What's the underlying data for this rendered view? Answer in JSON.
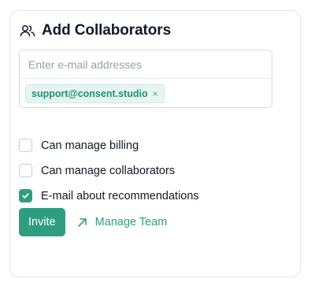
{
  "header": {
    "title": "Add Collaborators",
    "icon": "users-icon"
  },
  "email": {
    "placeholder": "Enter e-mail addresses",
    "value": "",
    "chips": [
      {
        "label": "support@consent.studio",
        "remove_icon": "close-icon"
      }
    ]
  },
  "options": [
    {
      "label": "Can manage billing",
      "checked": false
    },
    {
      "label": "Can manage collaborators",
      "checked": false
    },
    {
      "label": "E-mail about recommendations",
      "checked": true
    }
  ],
  "actions": {
    "invite_label": "Invite",
    "manage_label": "Manage Team",
    "manage_icon": "arrow-up-right-icon"
  },
  "colors": {
    "accent": "#2f9e80",
    "chip_bg": "#e7f5f1",
    "text": "#111827"
  }
}
